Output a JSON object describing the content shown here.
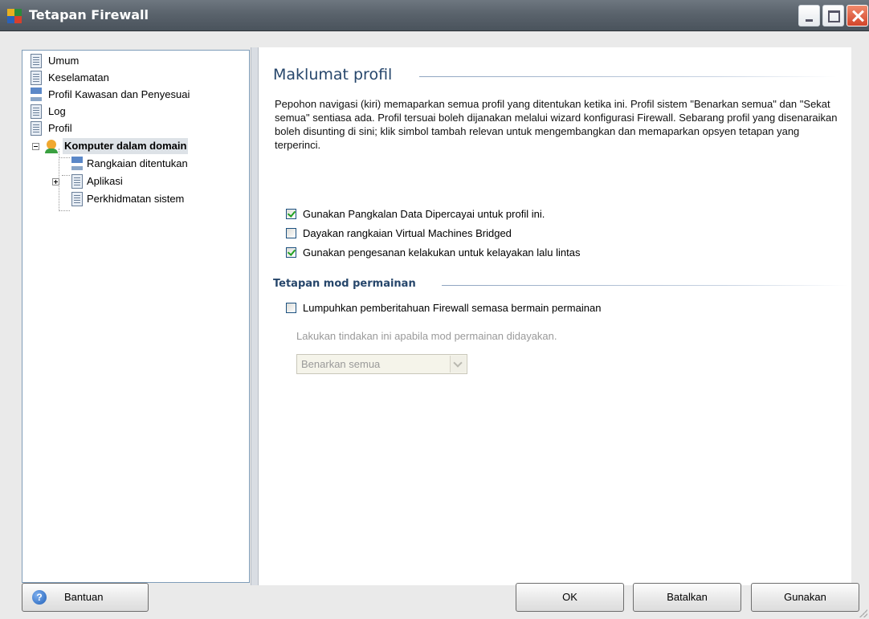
{
  "window": {
    "title": "Tetapan Firewall"
  },
  "tree": {
    "items": [
      {
        "label": "Umum"
      },
      {
        "label": "Keselamatan"
      },
      {
        "label": "Profil Kawasan dan Penyesuai"
      },
      {
        "label": "Log"
      },
      {
        "label": "Profil"
      },
      {
        "label": "Komputer dalam domain",
        "selected": true,
        "expanded": true
      },
      {
        "label": "Rangkaian ditentukan"
      },
      {
        "label": "Aplikasi",
        "expandable": true
      },
      {
        "label": "Perkhidmatan sistem"
      }
    ]
  },
  "profile": {
    "title": "Maklumat profil",
    "description": "Pepohon navigasi (kiri) memaparkan semua profil yang ditentukan ketika ini. Profil sistem \"Benarkan semua\" dan \"Sekat semua\" sentiasa ada. Profil tersuai boleh dijanakan melalui wizard konfigurasi Firewall. Sebarang profil yang disenaraikan boleh disunting di sini; klik simbol tambah relevan untuk mengembangkan dan memaparkan opsyen tetapan yang terperinci.",
    "options": [
      {
        "label": "Gunakan Pangkalan Data Dipercayai untuk profil ini.",
        "checked": true
      },
      {
        "label": "Dayakan rangkaian Virtual Machines Bridged",
        "checked": false
      },
      {
        "label": "Gunakan pengesanan kelakukan untuk kelayakan lalu lintas",
        "checked": true
      }
    ]
  },
  "game_mode": {
    "title": "Tetapan mod permainan",
    "option": {
      "label": "Lumpuhkan pemberitahuan Firewall semasa bermain permainan",
      "checked": false
    },
    "action_label": "Lakukan tindakan ini apabila mod permainan didayakan.",
    "action_value": "Benarkan semua"
  },
  "buttons": {
    "help": "Bantuan",
    "ok": "OK",
    "cancel": "Batalkan",
    "apply": "Gunakan"
  },
  "icons": {
    "app": "firewall-app-icon",
    "help": "help-icon"
  },
  "colors": {
    "heading": "#26466b",
    "check": "#21a121",
    "titlebar": "#5a636c"
  }
}
